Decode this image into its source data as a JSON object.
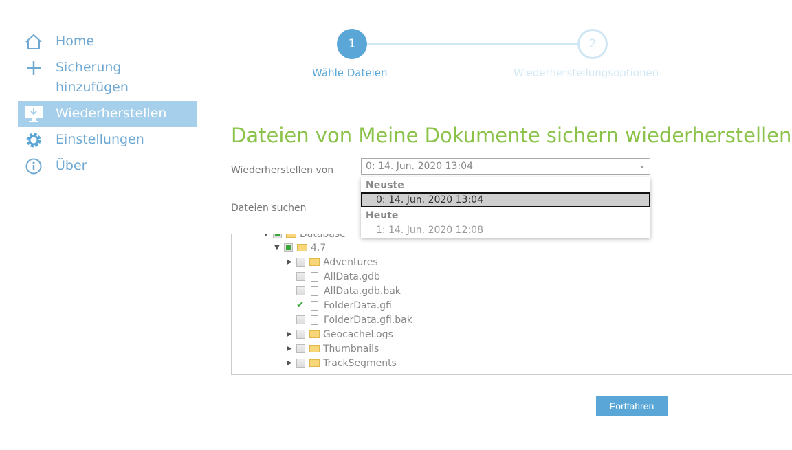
{
  "sidebar": {
    "items": [
      {
        "label": "Home",
        "icon": "home-icon"
      },
      {
        "label": "Sicherung\nhinzufügen",
        "icon": "plus-icon"
      },
      {
        "label": "Wiederherstellen",
        "icon": "monitor-download-icon",
        "active": true
      },
      {
        "label": "Einstellungen",
        "icon": "gear-icon"
      },
      {
        "label": "Über",
        "icon": "info-icon"
      }
    ]
  },
  "steps": [
    {
      "number": "1",
      "label": "Wähle Dateien"
    },
    {
      "number": "2",
      "label": "Wiederherstellungsoptionen"
    }
  ],
  "title": "Dateien von Meine Dokumente sichern wiederherstellen",
  "restore_from": {
    "label": "Wiederherstellen von",
    "value": "0: 14. Jun. 2020 13:04",
    "groups": [
      {
        "name": "Neuste",
        "options": [
          "0: 14. Jun. 2020 13:04"
        ]
      },
      {
        "name": "Heute",
        "options": [
          "1: 14. Jun. 2020 12:08"
        ]
      }
    ]
  },
  "search_label": "Dateien suchen",
  "tree": {
    "root": "Database",
    "folder": "4.7",
    "items": [
      {
        "name": "Adventures",
        "type": "folder"
      },
      {
        "name": "AllData.gdb",
        "type": "file"
      },
      {
        "name": "AllData.gdb.bak",
        "type": "file"
      },
      {
        "name": "FolderData.gfi",
        "type": "file",
        "checked": true
      },
      {
        "name": "FolderData.gfi.bak",
        "type": "file"
      },
      {
        "name": "GeocacheLogs",
        "type": "folder"
      },
      {
        "name": "Thumbnails",
        "type": "folder"
      },
      {
        "name": "TrackSegments",
        "type": "folder"
      }
    ]
  },
  "continue_label": "Fortfahren"
}
